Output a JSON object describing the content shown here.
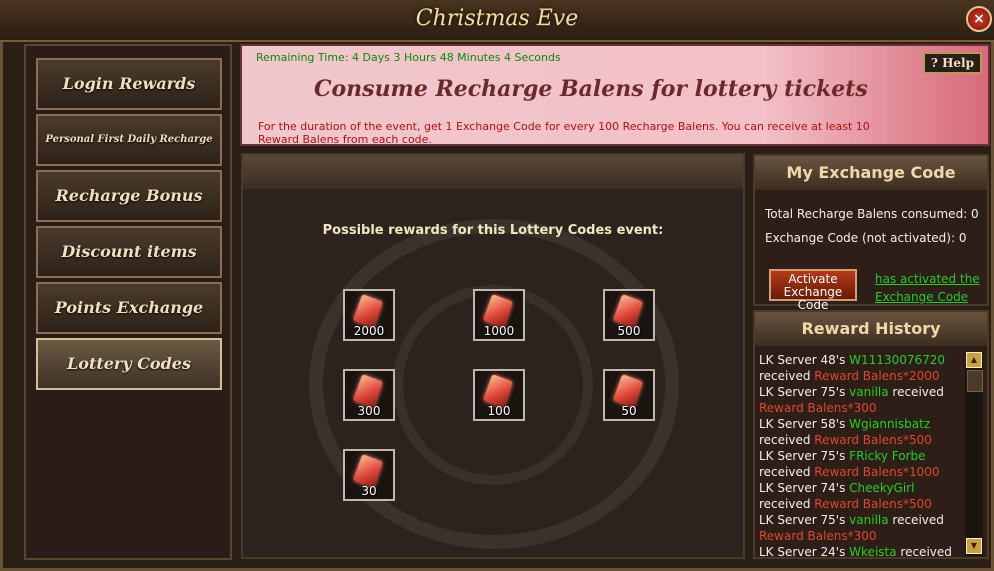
{
  "window": {
    "title": "Christmas Eve",
    "close_label": "×"
  },
  "nav": [
    {
      "label": "Login Rewards",
      "active": false,
      "small": false
    },
    {
      "label": "Personal First Daily Recharge",
      "active": false,
      "small": true
    },
    {
      "label": "Recharge Bonus",
      "active": false,
      "small": false
    },
    {
      "label": "Discount items",
      "active": false,
      "small": false
    },
    {
      "label": "Points Exchange",
      "active": false,
      "small": false
    },
    {
      "label": "Lottery Codes",
      "active": true,
      "small": false
    }
  ],
  "banner": {
    "remaining": "Remaining Time: 4 Days 3 Hours 48 Minutes 4 Seconds",
    "headline": "Consume Recharge Balens for lottery tickets",
    "description": "For the duration of the event, get 1 Exchange Code for every 100 Recharge Balens. You can receive at least 10 Reward Balens from each code.",
    "help": "? Help"
  },
  "rewards": {
    "heading": "Possible rewards for this Lottery Codes event:",
    "items": [
      "2000",
      "1000",
      "500",
      "300",
      "100",
      "50",
      "30"
    ]
  },
  "exchange": {
    "title": "My Exchange Code",
    "consumed": "Total Recharge Balens consumed: 0",
    "codes": "Exchange Code (not activated): 0",
    "activate_line1": "Activate",
    "activate_line2": "Exchange Code",
    "activated_line1": "has activated the",
    "activated_line2": "Exchange Code"
  },
  "history": {
    "title": "Reward History",
    "entries": [
      {
        "server": "LK Server 48's ",
        "player": "W11130076720",
        "mid": " received ",
        "reward": "Reward Balens*2000"
      },
      {
        "server": "LK Server 75's ",
        "player": "vanilla",
        "mid": " received ",
        "reward": "Reward Balens*300"
      },
      {
        "server": "LK Server 58's ",
        "player": "Wgiannisbatz",
        "mid": " received ",
        "reward": "Reward Balens*500"
      },
      {
        "server": "LK Server 75's ",
        "player": "FRicky Forbe",
        "mid": " received ",
        "reward": "Reward Balens*1000"
      },
      {
        "server": "LK Server 74's ",
        "player": "CheekyGirl",
        "mid": " received ",
        "reward": "Reward Balens*500"
      },
      {
        "server": "LK Server 75's ",
        "player": "vanilla",
        "mid": " received ",
        "reward": "Reward Balens*300"
      },
      {
        "server": "LK Server 24's ",
        "player": "Wkeista",
        "mid": " received",
        "reward": ""
      }
    ]
  },
  "colors": {
    "player": "#20d020",
    "reward": "#e04828",
    "timer": "#0a8a0a"
  }
}
